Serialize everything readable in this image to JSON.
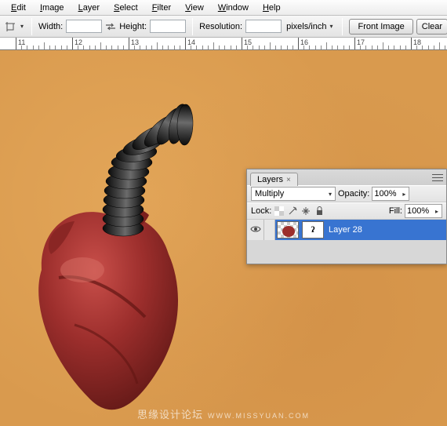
{
  "menu": {
    "items": [
      "Edit",
      "Image",
      "Layer",
      "Select",
      "Filter",
      "View",
      "Window",
      "Help"
    ]
  },
  "options": {
    "width_label": "Width:",
    "width_value": "",
    "swap_tooltip": "Swap",
    "height_label": "Height:",
    "height_value": "",
    "resolution_label": "Resolution:",
    "resolution_value": "",
    "units": "pixels/inch",
    "front_image": "Front Image",
    "clear": "Clear"
  },
  "ruler": {
    "marks": [
      "11",
      "12",
      "13",
      "14",
      "15",
      "16",
      "17",
      "18"
    ]
  },
  "layers_panel": {
    "tab": "Layers",
    "blend_mode": "Multiply",
    "opacity_label": "Opacity:",
    "opacity_value": "100%",
    "lock_label": "Lock:",
    "fill_label": "Fill:",
    "fill_value": "100%",
    "layer": {
      "name": "Layer 28",
      "mask_symbol": "ʔ"
    }
  },
  "watermark": {
    "cn": "思缘设计论坛",
    "en": "WWW.MISSYUAN.COM"
  }
}
